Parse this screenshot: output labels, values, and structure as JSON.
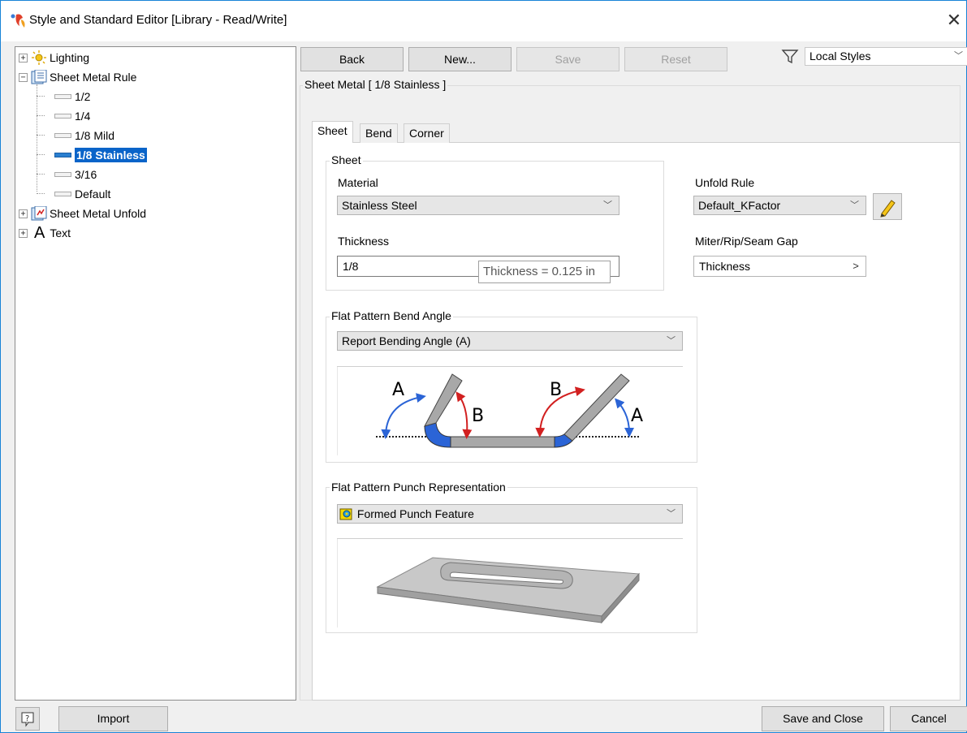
{
  "window": {
    "title": "Style and Standard Editor [Library - Read/Write]",
    "close_glyph": "✕"
  },
  "tree": {
    "items": [
      {
        "label": "Lighting",
        "icon": "lighting-icon",
        "expander": "+"
      },
      {
        "label": "Sheet Metal Rule",
        "icon": "sheet-metal-rule-icon",
        "expander": "−"
      },
      {
        "label": "1/2"
      },
      {
        "label": "1/4"
      },
      {
        "label": "1/8 Mild"
      },
      {
        "label": "1/8 Stainless",
        "selected": true
      },
      {
        "label": "3/16"
      },
      {
        "label": "Default"
      },
      {
        "label": "Sheet Metal Unfold",
        "icon": "sheet-metal-unfold-icon",
        "expander": "+"
      },
      {
        "label": "Text",
        "icon": "text-style-icon",
        "expander": "+",
        "glyph": "A"
      }
    ]
  },
  "toolbar": {
    "back": "Back",
    "new": "New...",
    "save": "Save",
    "reset": "Reset",
    "filter_value": "Local Styles"
  },
  "style_header": "Sheet Metal [ 1/8 Stainless ]",
  "tabs": [
    "Sheet",
    "Bend",
    "Corner"
  ],
  "sheet": {
    "group_title": "Sheet",
    "material_label": "Material",
    "material_value": "Stainless Steel",
    "thickness_label": "Thickness",
    "thickness_value": "1/8",
    "thickness_tooltip": "Thickness = 0.125 in",
    "unfold_rule_label": "Unfold Rule",
    "unfold_rule_value": "Default_KFactor",
    "gap_label": "Miter/Rip/Seam Gap",
    "gap_value": "Thickness",
    "gap_arrow": ">"
  },
  "bend_angle": {
    "group_title": "Flat Pattern Bend Angle",
    "value": "Report Bending Angle (A)",
    "diagram_labels": {
      "a": "A",
      "b": "B"
    }
  },
  "punch": {
    "group_title": "Flat Pattern Punch Representation",
    "value": "Formed Punch Feature"
  },
  "footer": {
    "import": "Import",
    "save_close": "Save and Close",
    "cancel": "Cancel",
    "help_glyph": "?"
  },
  "colors": {
    "selection": "#0a64c9",
    "window_border": "#1883d7",
    "bend_blue": "#2b64d6",
    "angle_red": "#d22020"
  }
}
